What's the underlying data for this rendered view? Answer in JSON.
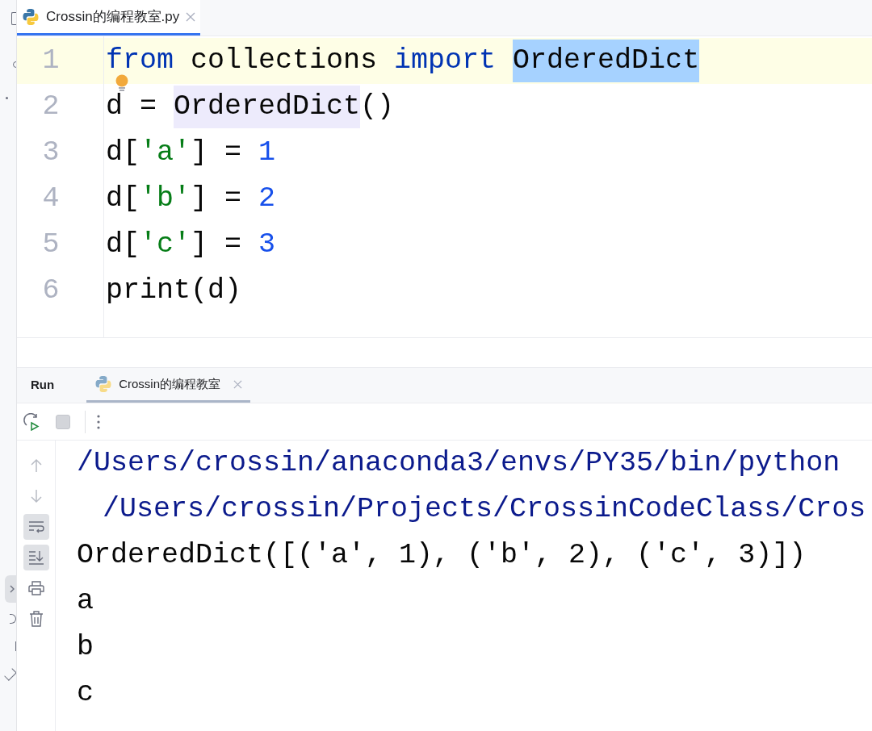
{
  "editor_tabs": [
    {
      "label": "Crossin的编程教室.py",
      "selected": true
    }
  ],
  "editor": {
    "lines": [
      {
        "number": "1",
        "current": true,
        "tokens": [
          {
            "text": "from",
            "kind": "keyword"
          },
          {
            "text": " collections ",
            "kind": "plain"
          },
          {
            "text": "import ",
            "kind": "keyword"
          },
          {
            "text": "OrderedDict",
            "kind": "selected"
          }
        ]
      },
      {
        "number": "2",
        "current": false,
        "bulb": true,
        "tokens": [
          {
            "text": "d",
            "kind": "plain"
          },
          {
            "text": " = ",
            "kind": "plain"
          },
          {
            "text": "OrderedDict",
            "kind": "usage"
          },
          {
            "text": "()",
            "kind": "plain"
          }
        ]
      },
      {
        "number": "3",
        "current": false,
        "tokens": [
          {
            "text": "d[",
            "kind": "plain"
          },
          {
            "text": "'a'",
            "kind": "string"
          },
          {
            "text": "] = ",
            "kind": "plain"
          },
          {
            "text": "1",
            "kind": "number"
          }
        ]
      },
      {
        "number": "4",
        "current": false,
        "tokens": [
          {
            "text": "d[",
            "kind": "plain"
          },
          {
            "text": "'b'",
            "kind": "string"
          },
          {
            "text": "] = ",
            "kind": "plain"
          },
          {
            "text": "2",
            "kind": "number"
          }
        ]
      },
      {
        "number": "5",
        "current": false,
        "tokens": [
          {
            "text": "d[",
            "kind": "plain"
          },
          {
            "text": "'c'",
            "kind": "string"
          },
          {
            "text": "] = ",
            "kind": "plain"
          },
          {
            "text": "3",
            "kind": "number"
          }
        ]
      },
      {
        "number": "6",
        "current": false,
        "tokens": [
          {
            "text": "print(d)",
            "kind": "plain"
          }
        ]
      }
    ]
  },
  "run_panel": {
    "title": "Run",
    "tabs": [
      {
        "label": "Crossin的编程教室",
        "selected": true
      }
    ],
    "toolbar": [
      {
        "kind": "rerun"
      },
      {
        "kind": "stop"
      },
      {
        "kind": "more"
      }
    ],
    "side_tools": [
      {
        "kind": "up",
        "on": false
      },
      {
        "kind": "down",
        "on": false
      },
      {
        "kind": "wrap",
        "on": true
      },
      {
        "kind": "scroll-end",
        "on": true
      },
      {
        "kind": "print",
        "on": false
      },
      {
        "kind": "trash",
        "on": false
      }
    ],
    "console": [
      {
        "text": "/Users/crossin/anaconda3/envs/PY35/bin/python",
        "kind": "command"
      },
      {
        "text": "/Users/crossin/Projects/CrossinCodeClass/Cros",
        "kind": "continuation"
      },
      {
        "text": "OrderedDict([('a', 1), ('b', 2), ('c', 3)])",
        "kind": "output"
      },
      {
        "text": "a",
        "kind": "output"
      },
      {
        "text": "b",
        "kind": "output"
      },
      {
        "text": "c",
        "kind": "output"
      }
    ]
  }
}
